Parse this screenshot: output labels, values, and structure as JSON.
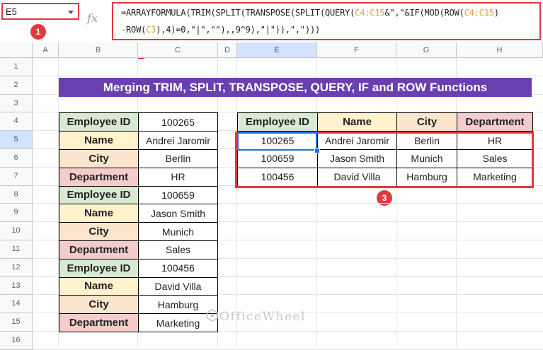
{
  "name_box": {
    "value": "E5"
  },
  "formula_bar": {
    "fx_label": "fx",
    "line1_parts": [
      {
        "t": "=ARRAYFORMULA(TRIM(SPLIT(TRANSPOSE(SPLIT(QUERY(",
        "c": "n"
      },
      {
        "t": "C4:C15",
        "c": "r"
      },
      {
        "t": "&\",\"&IF(MOD(ROW(",
        "c": "n"
      },
      {
        "t": "C4:C15",
        "c": "r"
      },
      {
        "t": ")",
        "c": "n"
      }
    ],
    "line2_parts": [
      {
        "t": "-ROW(",
        "c": "n"
      },
      {
        "t": "C3",
        "c": "r"
      },
      {
        "t": "),4)=0,\"|\",\"\"),,9^9),\"|\")),\",\")))",
        "c": "n"
      }
    ]
  },
  "badges": [
    "1",
    "2",
    "3"
  ],
  "columns": [
    "A",
    "B",
    "C",
    "D",
    "E",
    "F",
    "G",
    "H"
  ],
  "rows": [
    "1",
    "2",
    "3",
    "4",
    "5",
    "6",
    "7",
    "8",
    "9",
    "10",
    "11",
    "12",
    "13",
    "14",
    "15",
    "16"
  ],
  "title": "Merging TRIM, SPLIT, TRANSPOSE, QUERY, IF and ROW Functions",
  "source_table": [
    {
      "label": "Employee ID",
      "value": "100265"
    },
    {
      "label": "Name",
      "value": "Andrei Jaromir"
    },
    {
      "label": "City",
      "value": "Berlin"
    },
    {
      "label": "Department",
      "value": "HR"
    },
    {
      "label": "Employee ID",
      "value": "100659"
    },
    {
      "label": "Name",
      "value": "Jason Smith"
    },
    {
      "label": "City",
      "value": "Munich"
    },
    {
      "label": "Department",
      "value": "Sales"
    },
    {
      "label": "Employee ID",
      "value": "100456"
    },
    {
      "label": "Name",
      "value": "David Villa"
    },
    {
      "label": "City",
      "value": "Hamburg"
    },
    {
      "label": "Department",
      "value": "Marketing"
    }
  ],
  "result_table": {
    "headers": [
      "Employee ID",
      "Name",
      "City",
      "Department"
    ],
    "rows": [
      [
        "100265",
        "Andrei Jaromir",
        "Berlin",
        "HR"
      ],
      [
        "100659",
        "Jason Smith",
        "Munich",
        "Sales"
      ],
      [
        "100456",
        "David Villa",
        "Hamburg",
        "Marketing"
      ]
    ]
  },
  "label_colors": {
    "Employee ID": "#d9ead3",
    "Name": "#fff2cc",
    "City": "#fce5cd",
    "Department": "#f4cccc"
  },
  "colors": {
    "title_bg": "#6a3fb0",
    "highlight": "#e0393e",
    "selection": "#1a73e8",
    "formula_ref": "#e6a13c"
  },
  "watermark": "OfficeWheel"
}
